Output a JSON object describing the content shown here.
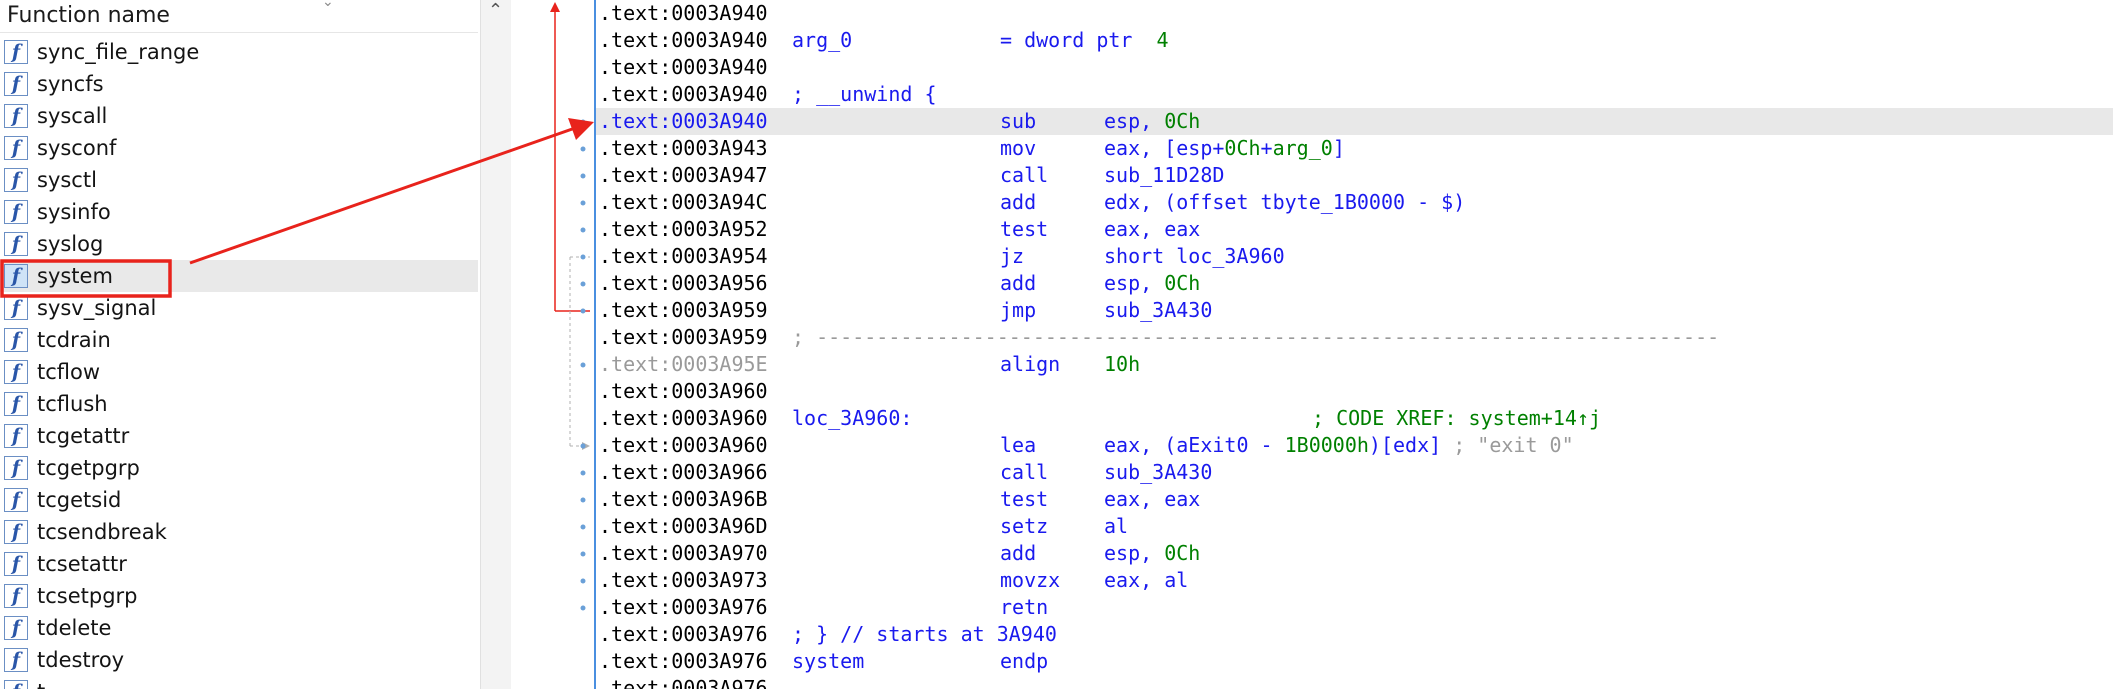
{
  "func_list": {
    "header": "Function name",
    "icon_glyph": "f",
    "items": [
      {
        "name": "sync_file_range",
        "selected": false
      },
      {
        "name": "syncfs",
        "selected": false
      },
      {
        "name": "syscall",
        "selected": false
      },
      {
        "name": "sysconf",
        "selected": false
      },
      {
        "name": "sysctl",
        "selected": false
      },
      {
        "name": "sysinfo",
        "selected": false
      },
      {
        "name": "syslog",
        "selected": false
      },
      {
        "name": "system",
        "selected": true
      },
      {
        "name": "sysv_signal",
        "selected": false
      },
      {
        "name": "tcdrain",
        "selected": false
      },
      {
        "name": "tcflow",
        "selected": false
      },
      {
        "name": "tcflush",
        "selected": false
      },
      {
        "name": "tcgetattr",
        "selected": false
      },
      {
        "name": "tcgetpgrp",
        "selected": false
      },
      {
        "name": "tcgetsid",
        "selected": false
      },
      {
        "name": "tcsendbreak",
        "selected": false
      },
      {
        "name": "tcsetattr",
        "selected": false
      },
      {
        "name": "tcsetpgrp",
        "selected": false
      },
      {
        "name": "tdelete",
        "selected": false
      },
      {
        "name": "tdestroy",
        "selected": false
      },
      {
        "name": "t",
        "selected": false
      }
    ]
  },
  "disasm": {
    "lines": [
      {
        "addr": ".text:0003A940",
        "kind": "blank"
      },
      {
        "addr": ".text:0003A940",
        "kind": "var",
        "name": "arg_0",
        "def": "= dword ptr",
        "value": "4"
      },
      {
        "addr": ".text:0003A940",
        "kind": "blank"
      },
      {
        "addr": ".text:0003A940",
        "kind": "label",
        "text": "; __unwind {"
      },
      {
        "addr": ".text:0003A940",
        "kind": "insn",
        "mnem": "sub",
        "ops_html": "esp, <span class=\"num\">0Ch</span>",
        "current": true
      },
      {
        "addr": ".text:0003A943",
        "kind": "insn",
        "mnem": "mov",
        "ops_html": "eax, [esp+<span class=\"num\">0Ch</span>+<span class=\"num\">arg_0</span>]"
      },
      {
        "addr": ".text:0003A947",
        "kind": "insn",
        "mnem": "call",
        "ops_html": "sub_11D28D"
      },
      {
        "addr": ".text:0003A94C",
        "kind": "insn",
        "mnem": "add",
        "ops_html": "edx, (offset tbyte_1B0000 - $)"
      },
      {
        "addr": ".text:0003A952",
        "kind": "insn",
        "mnem": "test",
        "ops_html": "eax, eax"
      },
      {
        "addr": ".text:0003A954",
        "kind": "insn",
        "mnem": "jz",
        "ops_html": "short loc_3A960"
      },
      {
        "addr": ".text:0003A956",
        "kind": "insn",
        "mnem": "add",
        "ops_html": "esp, <span class=\"num\">0Ch</span>"
      },
      {
        "addr": ".text:0003A959",
        "kind": "insn",
        "mnem": "jmp",
        "ops_html": "sub_3A430"
      },
      {
        "addr": ".text:0003A959",
        "kind": "sep",
        "text": "; ---------------------------------------------------------------------------"
      },
      {
        "addr": ".text:0003A95E",
        "kind": "insn",
        "mnem": "align",
        "ops_html": "<span class=\"num\">10h</span>",
        "dim": true
      },
      {
        "addr": ".text:0003A960",
        "kind": "blank"
      },
      {
        "addr": ".text:0003A960",
        "kind": "labelxref",
        "text": "loc_3A960:",
        "xref": "; CODE XREF: system+14↑j"
      },
      {
        "addr": ".text:0003A960",
        "kind": "insn",
        "mnem": "lea",
        "ops_html": "eax, (aExit0 - <span class=\"num\">1B0000h</span>)[edx] <span class=\"cmt\">; \"exit 0\"</span>"
      },
      {
        "addr": ".text:0003A966",
        "kind": "insn",
        "mnem": "call",
        "ops_html": "sub_3A430"
      },
      {
        "addr": ".text:0003A96B",
        "kind": "insn",
        "mnem": "test",
        "ops_html": "eax, eax"
      },
      {
        "addr": ".text:0003A96D",
        "kind": "insn",
        "mnem": "setz",
        "ops_html": "al"
      },
      {
        "addr": ".text:0003A970",
        "kind": "insn",
        "mnem": "add",
        "ops_html": "esp, <span class=\"num\">0Ch</span>"
      },
      {
        "addr": ".text:0003A973",
        "kind": "insn",
        "mnem": "movzx",
        "ops_html": "eax, al"
      },
      {
        "addr": ".text:0003A976",
        "kind": "insn",
        "mnem": "retn",
        "ops_html": ""
      },
      {
        "addr": ".text:0003A976",
        "kind": "label",
        "text": "; } // starts at 3A940"
      },
      {
        "addr": ".text:0003A976",
        "kind": "proc",
        "name": "system",
        "mnem": "endp"
      },
      {
        "addr": ".text:0003A976",
        "kind": "blank"
      }
    ]
  },
  "colors": {
    "annotation": "#e8231c",
    "panel_border": "#4a8fe0",
    "keyword": "#1a1aee",
    "number": "#008000",
    "comment": "#9a9a9a"
  }
}
